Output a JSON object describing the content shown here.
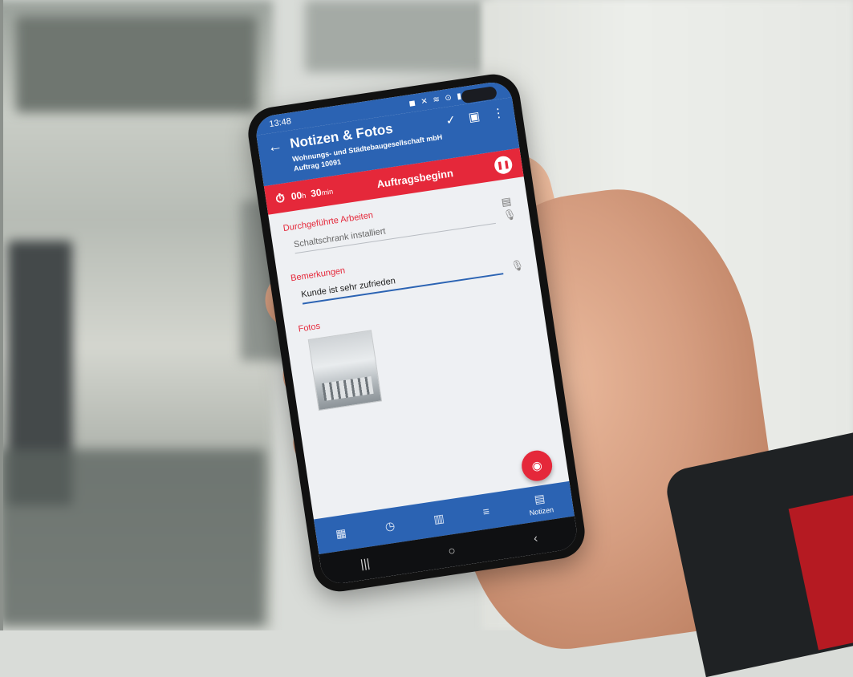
{
  "status": {
    "time": "13:48",
    "icons": "◼ ✕ ≋ ⊙ ▮"
  },
  "header": {
    "back_icon": "←",
    "title": "Notizen & Fotos",
    "subtitle_line1": "Wohnungs- und Städtebaugesellschaft mbH",
    "subtitle_line2": "Auftrag 10091",
    "confirm_icon": "✓",
    "gallery_icon": "▣",
    "menu_icon": "⋮"
  },
  "timer": {
    "stopwatch_icon": "⏱",
    "hours": "00",
    "hours_unit": "h",
    "minutes": "30",
    "minutes_unit": "min",
    "label": "Auftragsbeginn",
    "pause_icon": "❚❚"
  },
  "sections": {
    "work_title": "Durchgeführte Arbeiten",
    "work_value": "Schaltschrank installiert",
    "remarks_title": "Bemerkungen",
    "remarks_value": "Kunde ist sehr zufrieden",
    "photos_title": "Fotos"
  },
  "icons": {
    "mic": "🎙",
    "doc": "▤",
    "camera": "◉"
  },
  "bottom_nav": [
    {
      "icon": "▦",
      "label": ""
    },
    {
      "icon": "◷",
      "label": ""
    },
    {
      "icon": "▥",
      "label": ""
    },
    {
      "icon": "≡",
      "label": ""
    },
    {
      "icon": "▤",
      "label": "Notizen"
    }
  ],
  "system_nav": {
    "recent": "|||",
    "home": "○",
    "back": "‹"
  },
  "colors": {
    "primary": "#2b63b3",
    "accent": "#e5283a"
  }
}
